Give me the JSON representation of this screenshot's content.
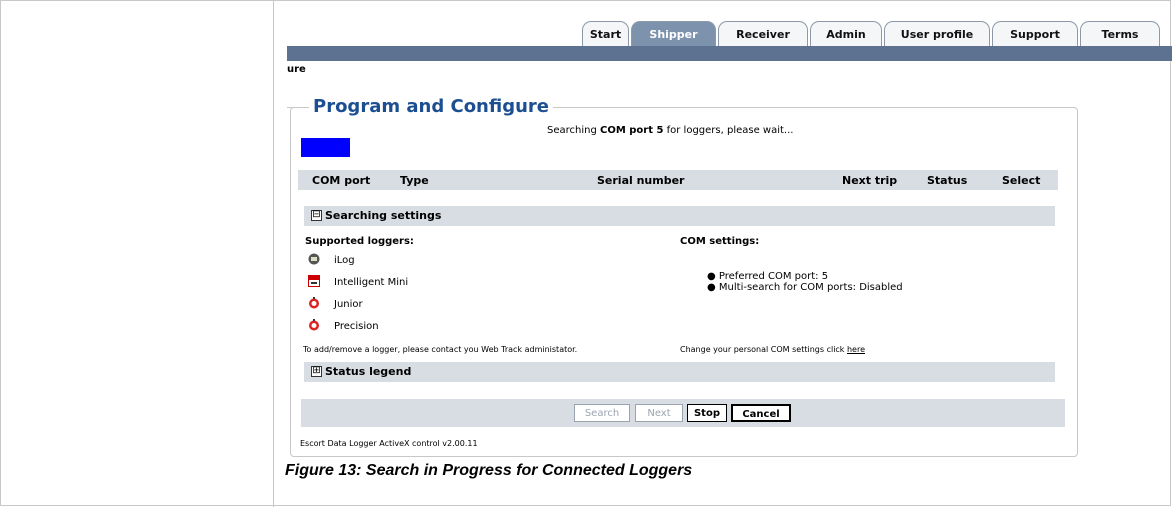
{
  "tabs": [
    {
      "label": "Start"
    },
    {
      "label": "Shipper"
    },
    {
      "label": "Receiver"
    },
    {
      "label": "Admin"
    },
    {
      "label": "User profile"
    },
    {
      "label": "Support"
    },
    {
      "label": "Terms"
    }
  ],
  "breadcrumb": "ure",
  "panel_title": "Program and Configure",
  "status": {
    "prefix": "Searching ",
    "port": "COM port 5",
    "suffix": " for loggers, please wait..."
  },
  "columns": [
    "COM port",
    "Type",
    "Serial number",
    "Next trip",
    "Status",
    "Select"
  ],
  "searching_settings": {
    "toggle": "⊟",
    "label": "Searching settings",
    "supported_title": "Supported loggers:",
    "loggers": [
      "iLog",
      "Intelligent Mini",
      "Junior",
      "Precision"
    ],
    "com_title": "COM settings:",
    "com_items": [
      "Preferred COM port: 5",
      "Multi-search for COM ports: Disabled"
    ],
    "add_note": "To add/remove a logger, please contact you Web Track administator.",
    "change_note": "Change your personal COM settings click ",
    "change_link": "here"
  },
  "status_legend": {
    "toggle": "⊞",
    "label": "Status legend"
  },
  "buttons": {
    "search": "Search",
    "next": "Next",
    "stop": "Stop",
    "cancel": "Cancel"
  },
  "footer": "Escort Data Logger ActiveX control v2.00.11",
  "caption": "Figure 13: Search in Progress for Connected Loggers",
  "colors": {
    "accent_blue": "#1c4f92",
    "progress_blue": "#0000ff",
    "tab_bar": "#5c7290",
    "header_gray": "#d8dde3"
  },
  "icons": [
    "ilog-logger-icon",
    "intelligent-mini-logger-icon",
    "junior-logger-icon",
    "precision-logger-icon"
  ]
}
